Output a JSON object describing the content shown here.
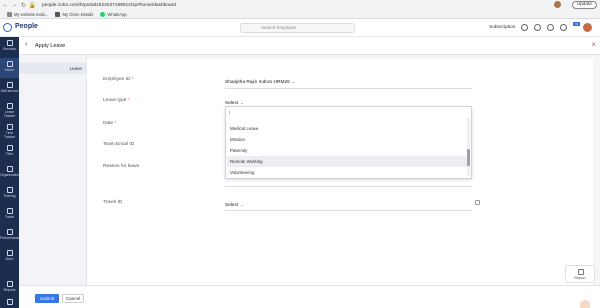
{
  "browser": {
    "url": "people.zoho.com/hrportal1524037199014/zp#home/dashboard",
    "bookmarks": [
      "My website tools...",
      "My Orion Details",
      "WhatsApp"
    ],
    "update_label": "Update"
  },
  "app": {
    "logo": "People",
    "search_placeholder": "Search Employee",
    "subscription": "Subscription",
    "notification_badge": "99"
  },
  "rail": {
    "items": [
      "Services",
      "Home",
      "Self-service",
      "Leave Tracker",
      "Time Tracker",
      "Files",
      "Organization",
      "Training",
      "Travel",
      "Performance",
      "More",
      "Reports",
      "Settings"
    ]
  },
  "page": {
    "title": "Apply Leave",
    "sidebar_tab": "Leave"
  },
  "form": {
    "employee_id_label": "Employee ID",
    "employee_id_value": "Shanjitha Rajin Indron HRM26",
    "leave_type_label": "Leave type",
    "leave_type_value": "Select",
    "date_label": "Date",
    "team_email_label": "Team Email ID",
    "reason_label": "Reason for leave",
    "travel_id_label": "Travel ID",
    "travel_id_value": "Select",
    "required_mark": "*"
  },
  "dropdown": {
    "search_value": "|",
    "options": [
      "Medical Leave",
      "Mission",
      "Paternity",
      "Remote Working",
      "Volunteering"
    ],
    "hovered": "Remote Working"
  },
  "footer": {
    "submit": "Submit",
    "cancel": "Cancel",
    "report": "Report"
  },
  "colors": {
    "accent": "#3577e8",
    "rail": "#1c2d4f",
    "close": "#d9534f"
  }
}
